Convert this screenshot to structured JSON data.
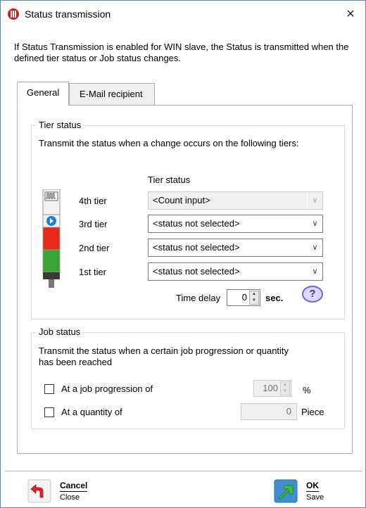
{
  "window": {
    "title": "Status transmission",
    "close_glyph": "×"
  },
  "info": "If Status Transmission is enabled for WIN slave, the Status is transmitted when the defined tier status or Job status changes.",
  "tabs": [
    {
      "label": "General",
      "active": true
    },
    {
      "label": "E-Mail recipient",
      "active": false
    }
  ],
  "tier_status": {
    "legend": "Tier status",
    "description": "Transmit the status when a change occurs on the following tiers:",
    "column_header": "Tier status",
    "tiers": [
      {
        "label": "4th tier",
        "value": "<Count input>",
        "disabled": true
      },
      {
        "label": "3rd tier",
        "value": "<status not selected>",
        "disabled": false
      },
      {
        "label": "2nd tier",
        "value": "<status not selected>",
        "disabled": false
      },
      {
        "label": "1st tier",
        "value": "<status not selected>",
        "disabled": false
      }
    ],
    "time_delay_label": "Time delay",
    "time_delay_value": "0",
    "time_delay_unit": "sec.",
    "help_glyph": "?"
  },
  "job_status": {
    "legend": "Job status",
    "description": "Transmit the status when a certain job progression or quantity has been reached",
    "progression_label": "At a job progression of",
    "progression_checked": false,
    "progression_value": "100",
    "progression_unit": "%",
    "quantity_label": "At a quantity of",
    "quantity_checked": false,
    "quantity_value": "0",
    "quantity_unit": "Piece"
  },
  "footer": {
    "cancel_title": "Cancel",
    "cancel_sub": "Close",
    "ok_title": "OK",
    "ok_sub": "Save"
  },
  "colors": {
    "tower_red": "#e8281b",
    "tower_green": "#3aa536",
    "tower_blue": "#1c7fd1",
    "help_ring": "#6f63d8",
    "brand_red": "#d21c1c"
  }
}
